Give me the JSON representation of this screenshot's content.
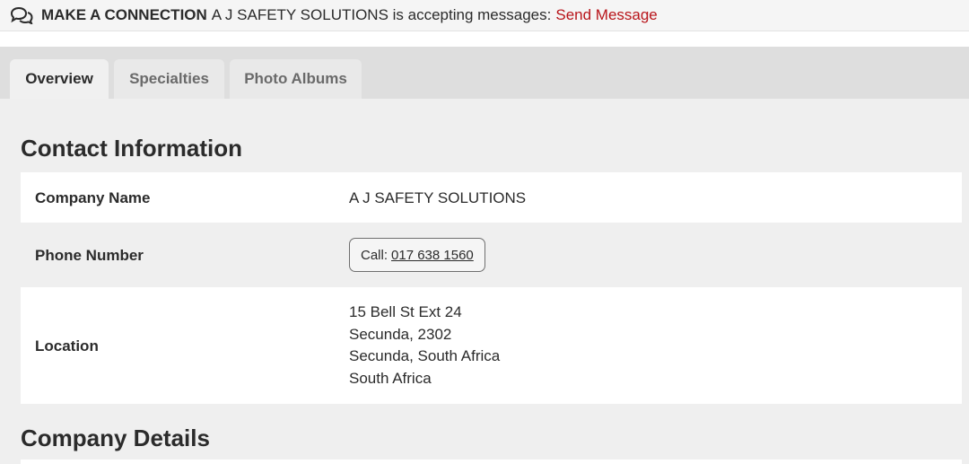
{
  "connection_bar": {
    "icon": "chat-bubbles-icon",
    "title": "MAKE A CONNECTION",
    "text": "A J SAFETY SOLUTIONS is accepting messages:",
    "link_label": "Send Message",
    "link_color": "#b8141a"
  },
  "tabs": [
    {
      "label": "Overview",
      "active": true
    },
    {
      "label": "Specialties",
      "active": false
    },
    {
      "label": "Photo Albums",
      "active": false
    }
  ],
  "contact": {
    "heading": "Contact Information",
    "company_label": "Company Name",
    "company_value": "A J SAFETY SOLUTIONS",
    "phone_label": "Phone Number",
    "call_prefix": "Call:",
    "phone_value": "017 638 1560",
    "location_label": "Location",
    "address": [
      "15 Bell St Ext 24",
      "Secunda, 2302",
      "Secunda, South Africa",
      "South Africa"
    ]
  },
  "company_details": {
    "heading": "Company Details"
  }
}
